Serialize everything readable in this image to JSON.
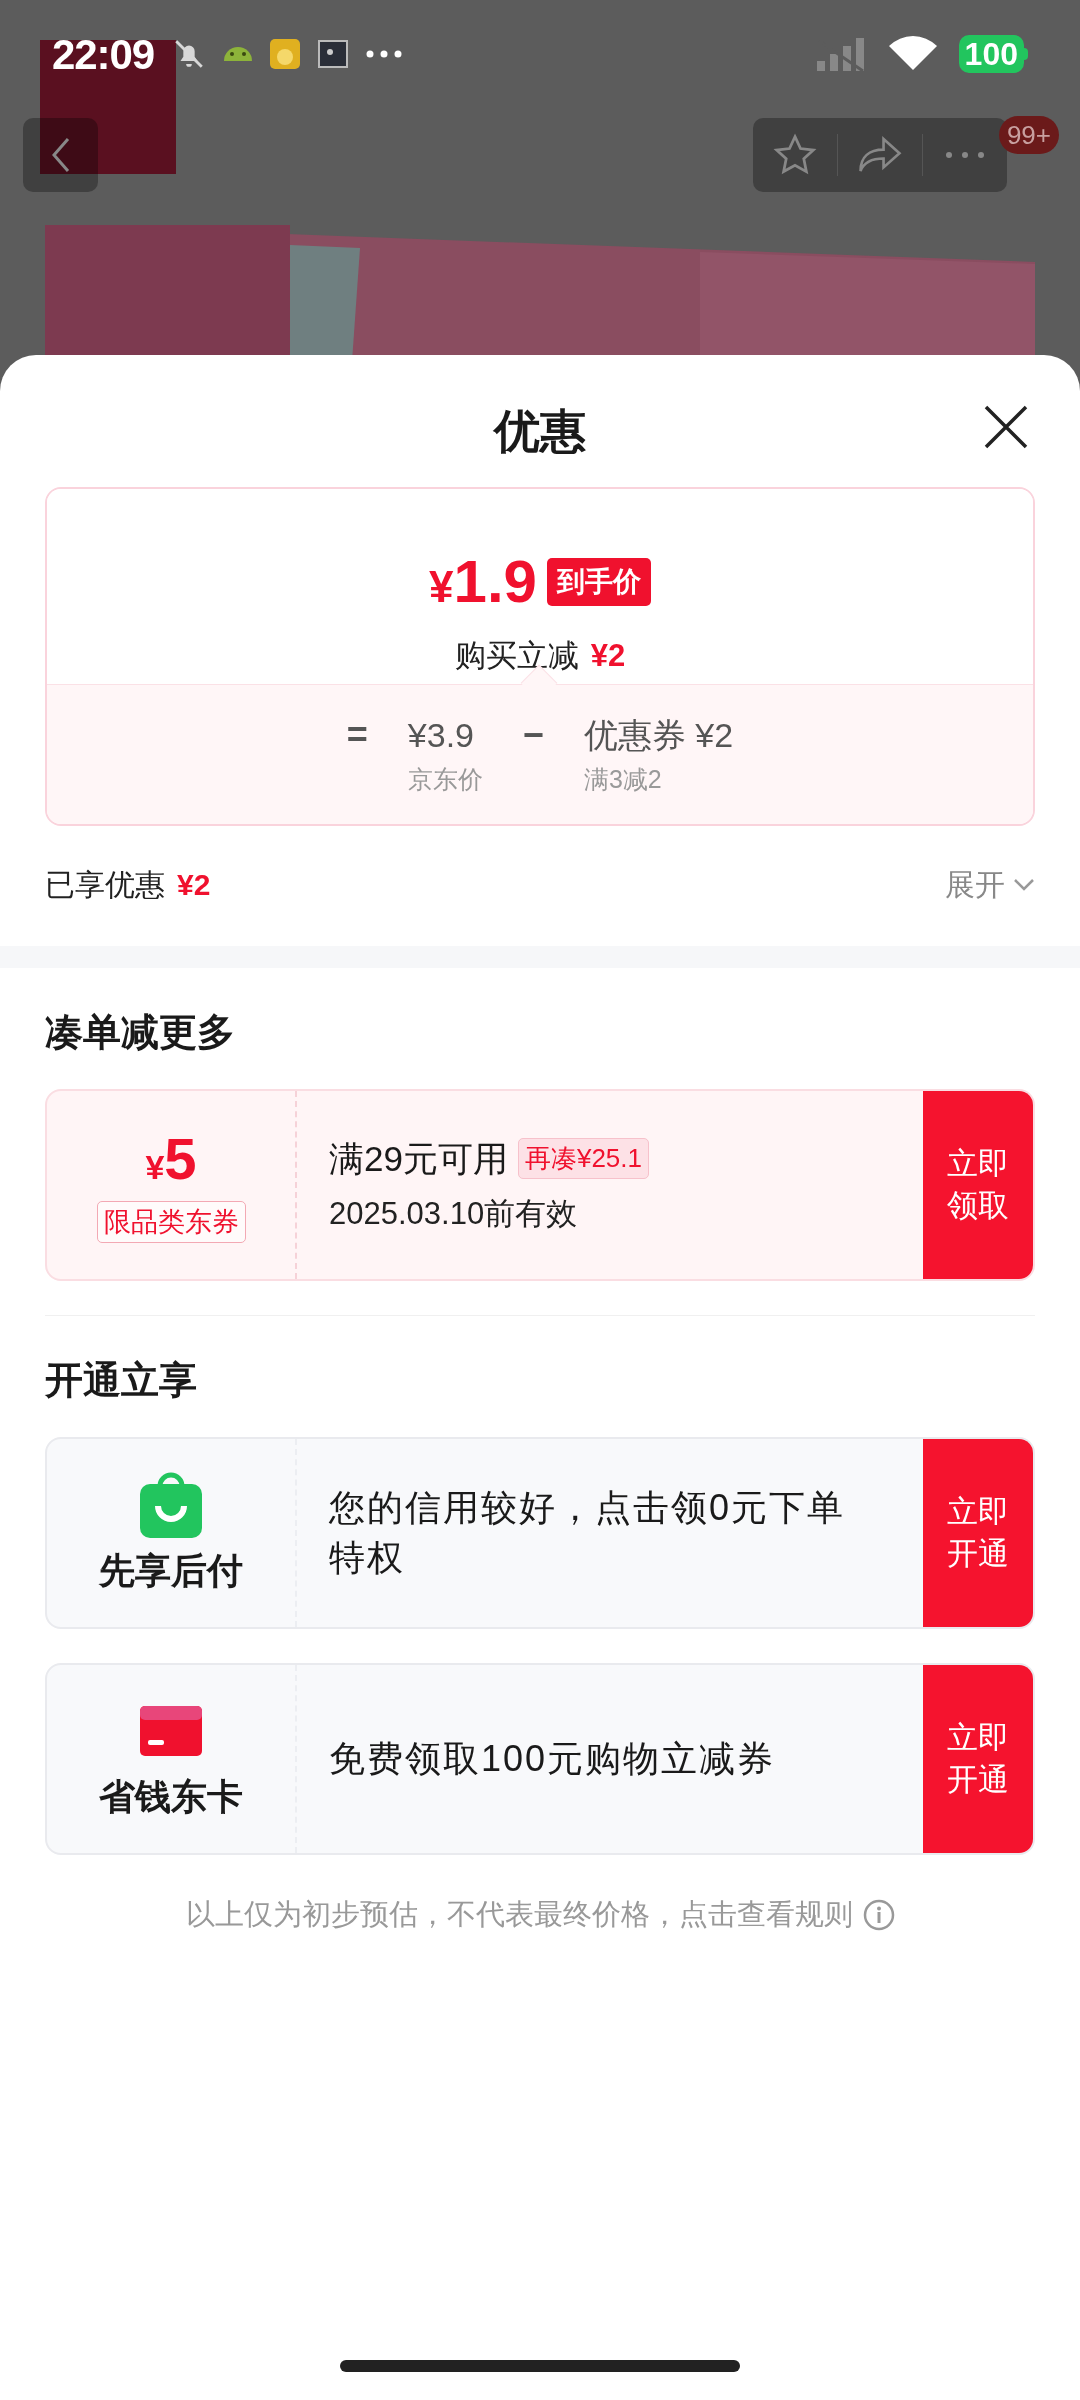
{
  "status_bar": {
    "time": "22:09",
    "battery": "100"
  },
  "nav": {
    "badge": "99+"
  },
  "sheet": {
    "title": "优惠",
    "price_card": {
      "price_symbol": "¥",
      "price": "1.9",
      "price_tag": "到手价",
      "reduction_label": "购买立减",
      "reduction_amount": "¥2",
      "formula": [
        {
          "kind": "operator",
          "text": "="
        },
        {
          "kind": "term",
          "value": "¥3.9",
          "caption": "京东价"
        },
        {
          "kind": "operator",
          "text": "−"
        },
        {
          "kind": "term",
          "value": "优惠券 ¥2",
          "caption": "满3减2"
        }
      ]
    },
    "enjoyed": {
      "label": "已享优惠",
      "amount": "¥2",
      "toggle": "展开",
      "expanded": false
    },
    "sections": [
      {
        "title": "凑单减更多",
        "cards": [
          {
            "kind": "coupon",
            "symbol": "¥",
            "amount": "5",
            "tag": "限品类东券",
            "condition": "满29元可用",
            "badge": "再凑¥25.1",
            "validity": "2025.03.10前有效",
            "action": "立即领取"
          }
        ]
      },
      {
        "title": "开通立享",
        "cards": [
          {
            "kind": "service",
            "name": "先享后付",
            "text": "您的信用较好，点击领0元下单特权",
            "action": "立即开通"
          },
          {
            "kind": "service",
            "name": "省钱东卡",
            "text": "免费领取100元购物立减券",
            "action": "立即开通"
          }
        ]
      }
    ],
    "footer": "以上仅为初步预估，不代表最终价格，点击查看规则"
  }
}
